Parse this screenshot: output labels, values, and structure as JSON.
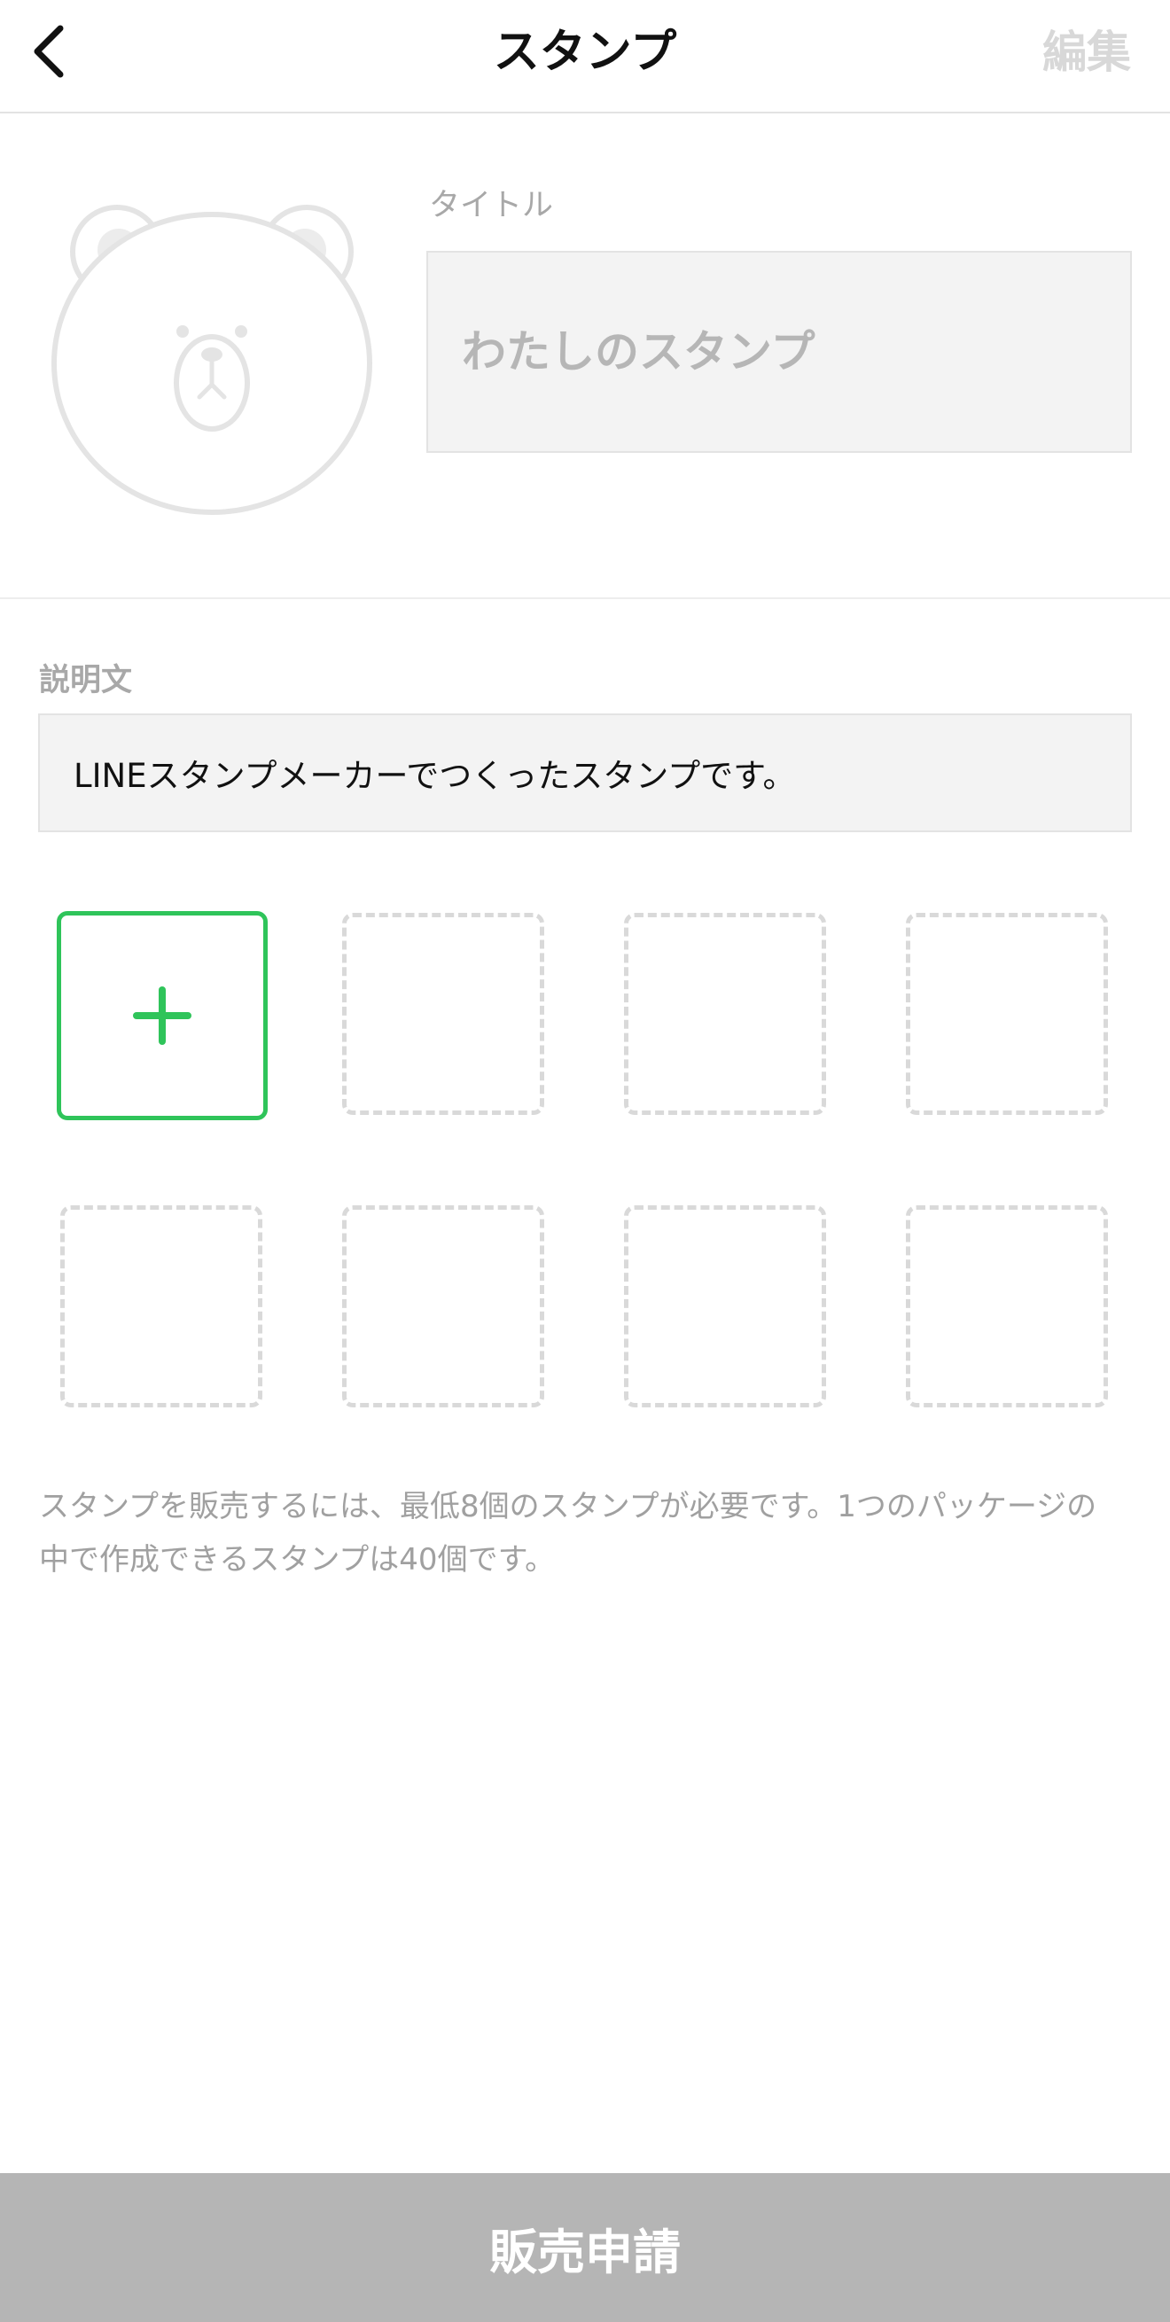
{
  "header": {
    "title": "スタンプ",
    "edit_label": "編集",
    "back_icon": "chevron-left-icon"
  },
  "profile": {
    "avatar_icon": "bear-placeholder-icon",
    "title_label": "タイトル",
    "title_placeholder": "わたしのスタンプ",
    "title_value": ""
  },
  "description": {
    "label": "説明文",
    "value": "LINEスタンプメーカーでつくったスタンプです。"
  },
  "stamps": {
    "add_icon": "plus-icon",
    "empty_slot_count": 7,
    "accent_color": "#2fc45a"
  },
  "note": {
    "line1": "スタンプを販売するには、最低8個のスタンプが必要です。1つのパッケージの",
    "line2": "中で作成できるスタンプは40個です。"
  },
  "footer": {
    "sell_label": "販売申請",
    "button_color": "#b5b5b5"
  }
}
